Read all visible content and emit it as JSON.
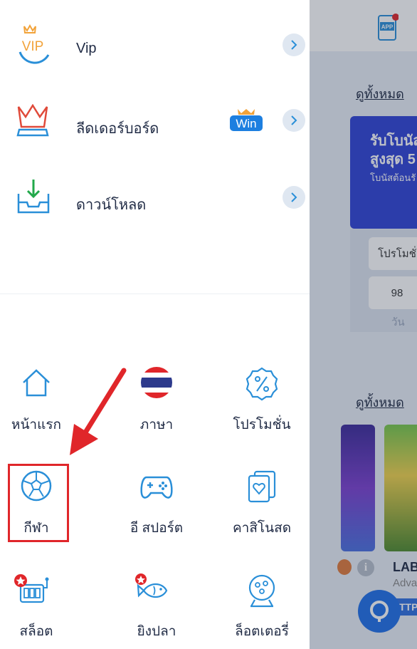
{
  "background": {
    "app_label": "APP",
    "see_all_top": "ดูทั้งหมด",
    "promo_title": "รับโบนัส สูงสุด 5",
    "promo_subtitle": "โบนัสต้อนรั",
    "promo_chip": "โปรโมชั่",
    "promo_value": "98",
    "promo_unit": "วัน",
    "see_all_bottom": "ดูทั้งหมด",
    "game_title": "LAB",
    "game_provider": "Adva",
    "game_badge": "TTP",
    "info_glyph": "i"
  },
  "menu": [
    {
      "label": "Vip",
      "icon": "vip-crown-icon"
    },
    {
      "label": "ลีดเดอร์บอร์ด",
      "icon": "leaderboard-crown-icon",
      "badge": "Win"
    },
    {
      "label": "ดาวน์โหลด",
      "icon": "download-tray-icon"
    }
  ],
  "grid": [
    {
      "label": "หน้าแรก",
      "icon": "home-icon"
    },
    {
      "label": "ภาษา",
      "icon": "thai-flag-icon"
    },
    {
      "label": "โปรโมชั่น",
      "icon": "promotion-percent-icon"
    },
    {
      "label": "กีฬา",
      "icon": "soccer-ball-icon"
    },
    {
      "label": "อี สปอร์ต",
      "icon": "gamepad-icon"
    },
    {
      "label": "คาสิโนสด",
      "icon": "playing-cards-icon"
    },
    {
      "label": "สล็อต",
      "icon": "slot-machine-icon"
    },
    {
      "label": "ยิงปลา",
      "icon": "fish-icon"
    },
    {
      "label": "ล็อตเตอรี่",
      "icon": "lottery-machine-icon"
    }
  ],
  "colors": {
    "accent_blue": "#2a8fd8",
    "highlight_red": "#e0262a",
    "promo_blue": "#2f42d6",
    "badge_blue": "#1d7fe0",
    "gold": "#f2a33a"
  },
  "vip_text": "VIP"
}
